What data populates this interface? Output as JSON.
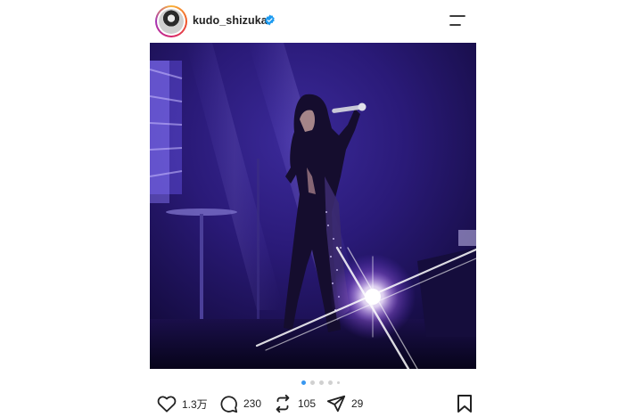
{
  "post": {
    "username": "kudo_shizuka",
    "verified": true,
    "accent_color": "#3897f0"
  },
  "carousel": {
    "total_dots": 5,
    "active_index": 0
  },
  "actions": {
    "likes": "1.3万",
    "comments": "230",
    "reposts": "105",
    "shares": "29"
  },
  "icons": {
    "like": "heart-icon",
    "comment": "comment-bubble-icon",
    "repost": "repost-icon",
    "share": "send-icon",
    "save": "bookmark-icon",
    "menu": "menu-icon",
    "verified": "verified-badge-icon"
  }
}
